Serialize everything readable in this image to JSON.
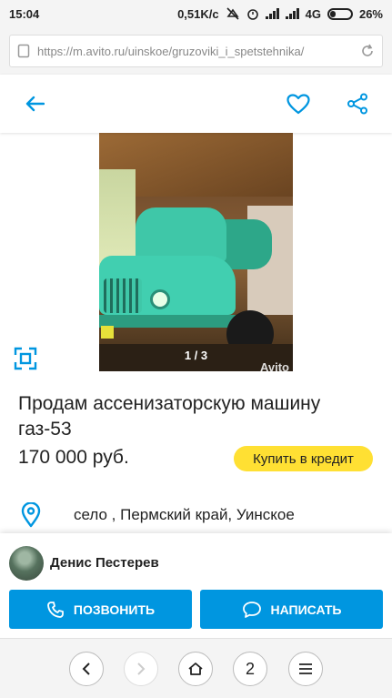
{
  "status_bar": {
    "time": "15:04",
    "network_speed": "0,51K/c",
    "network_type": "4G",
    "battery": "26%"
  },
  "browser": {
    "url": "https://m.avito.ru/uinskoe/gruzoviki_i_spetstehnika/",
    "tab_count": "2"
  },
  "colors": {
    "accent_blue": "#0096e0",
    "credit_yellow": "#ffe033"
  },
  "listing": {
    "photo_counter": "1 / 3",
    "watermark": "Avito",
    "title": "Продам ассенизаторскую машину газ-53",
    "price": "170 000 руб.",
    "credit_button": "Купить в кредит",
    "location": "село , Пермский край, Уинское"
  },
  "seller": {
    "name": "Денис Пестерев",
    "call_button": "ПОЗВОНИТЬ",
    "write_button": "НАПИСАТЬ"
  },
  "icons": [
    "back-arrow-icon",
    "heart-icon",
    "share-icon",
    "fullscreen-icon",
    "location-pin-icon",
    "phone-icon",
    "chat-icon",
    "reload-icon",
    "home-icon",
    "menu-icon"
  ]
}
